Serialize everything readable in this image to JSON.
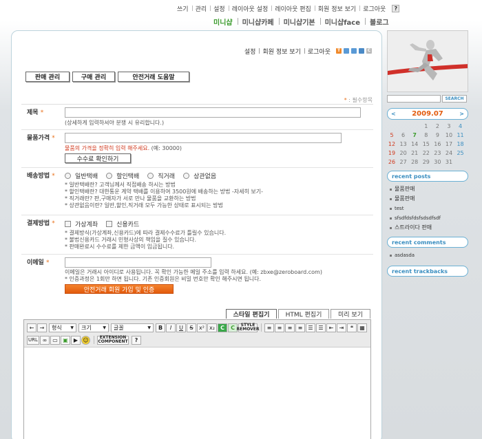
{
  "top_links": [
    "쓰기",
    "관리",
    "설정",
    "레이아웃 설정",
    "레이아웃 편집",
    "회원 정보 보기",
    "로그아웃"
  ],
  "help_label": "?",
  "nav_tabs": [
    {
      "label": "미니샵",
      "active": true
    },
    {
      "label": "미니샵카페",
      "active": false
    },
    {
      "label": "미니샵기본",
      "active": false
    },
    {
      "label": "미니샵face",
      "active": false
    },
    {
      "label": "블로그",
      "active": false
    }
  ],
  "header_links": [
    "설정",
    "회원 정보 보기",
    "로그아웃"
  ],
  "header_icons": [
    {
      "name": "orange-t-icon",
      "color": "#f08a2c",
      "glyph": "T"
    },
    {
      "name": "grid-blue-icon",
      "color": "#5a9ad6",
      "glyph": ""
    },
    {
      "name": "grid-blue2-icon",
      "color": "#5a9ad6",
      "glyph": ""
    },
    {
      "name": "grid-blue3-icon",
      "color": "#4a8ac6",
      "glyph": ""
    },
    {
      "name": "gray-c-icon",
      "color": "#bbbbbb",
      "glyph": "C"
    }
  ],
  "sub_buttons": [
    "판매 관리",
    "구매 관리",
    "안전거래 도움말"
  ],
  "required_note": {
    "star": "*",
    "text": " : 필수항목"
  },
  "form": {
    "title": {
      "label": "제목",
      "hint": "(상세하게 입력하셔야 분쟁 시 유리합니다.)"
    },
    "price": {
      "label": "물품가격",
      "hint": "물품의 가격을 정확히 입력 해주세요.",
      "example": " (예: 30000)",
      "button": "수수료 확인하기"
    },
    "delivery": {
      "label": "배송방법",
      "options": [
        "일반택배",
        "할인택배",
        "직거래",
        "상관없음"
      ],
      "notes": [
        "* 일반택배란? 고객님께서 직접배송 하시는 방법",
        "* 할인택배란? 대한통운 계약 택배를 이용하여 3500원에 배송하는 방법 -자세히 보기-",
        "* 직거래란? 판,구매자가 서로 만나 물품을 교환하는 방법",
        "* 상관없음이란? 일반,할인,직거래 모두 가능한 상태로 표시되는 방법"
      ]
    },
    "payment": {
      "label": "결제방법",
      "options": [
        "가상계좌",
        "신용카드"
      ],
      "notes": [
        "* 결제방식(가상계좌,신용카드)에 따라 결제수수료가 틀릴수 있습니다.",
        "* 불법신용카드 거래시 민형사상의 책임을 질수 있습니다.",
        "* 판매완료시 수수료를 제한 금액이 입금됩니다."
      ]
    },
    "email": {
      "label": "이메일",
      "notes": [
        "이메일은 거래시 아이디로 사용됩니다. 꼭 확인 가능한 메일 주소를 입력 하세요. (예: zbxe@zeroboard.com)",
        "* 인증과정은 1회만 하면 됩니다. 기존 인증회원은 비밀 번호만 확인 해주시면 됩니다."
      ],
      "button": "안전거래 회원 가입 및 인증"
    },
    "required_star": "*"
  },
  "editor_tabs": [
    {
      "label": "스타일 편집기",
      "active": true
    },
    {
      "label": "HTML 편집기",
      "active": false
    },
    {
      "label": "미리 보기",
      "active": false
    }
  ],
  "toolbar": {
    "format_label": "형식",
    "size_label": "크기",
    "font_label": "글꼴",
    "bold": "B",
    "italic": "I",
    "underline": "U",
    "strike": "S",
    "sup": "x²",
    "sub": "x₂",
    "style_remover": "STYLE REMOVER",
    "url_label": "URL",
    "extension_label": "EXTENSION COMPONENT",
    "help_label": "?"
  },
  "sidebar": {
    "search_button": "SEARCH",
    "calendar": {
      "prev": "<",
      "next": ">",
      "month": "2009.07",
      "weeks": [
        [
          "",
          "",
          "",
          "1",
          "2",
          "3",
          "4"
        ],
        [
          "5",
          "6",
          "7",
          "8",
          "9",
          "10",
          "11"
        ],
        [
          "12",
          "13",
          "14",
          "15",
          "16",
          "17",
          "18"
        ],
        [
          "19",
          "20",
          "21",
          "22",
          "23",
          "24",
          "25"
        ],
        [
          "26",
          "27",
          "28",
          "29",
          "30",
          "31",
          ""
        ]
      ],
      "today": "7"
    },
    "recent_posts_title": "recent posts",
    "recent_posts": [
      "물품판매",
      "물품판매",
      "test",
      "sfsdfdsfdsfsdsdfsdf",
      "스트라이다 판매"
    ],
    "recent_comments_title": "recent comments",
    "recent_comments": [
      "asdasda"
    ],
    "recent_trackbacks_title": "recent trackbacks"
  },
  "colors": {
    "accent_orange": "#e25a0c",
    "accent_blue": "#3a8ec0",
    "accent_green": "#3a9a2b"
  }
}
